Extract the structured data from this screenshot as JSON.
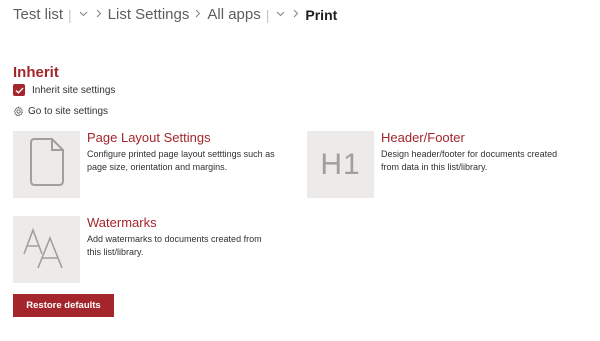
{
  "breadcrumb": {
    "items": [
      {
        "label": "Test list"
      },
      {
        "label": "List Settings"
      },
      {
        "label": "All apps"
      },
      {
        "label": "Print"
      }
    ]
  },
  "inherit": {
    "title": "Inherit",
    "checkbox_label": "Inherit site settings",
    "checked": true,
    "goto_label": "Go to site settings"
  },
  "tiles": [
    {
      "icon": "document-icon",
      "title": "Page Layout Settings",
      "desc_line1": "Configure printed page layout setttings such as",
      "desc_line2": "page size, orientation and margins."
    },
    {
      "icon": "h1-icon",
      "icon_text": "H1",
      "title": "Header/Footer",
      "desc_line1": "Design header/footer for documents created",
      "desc_line2": "from data in this list/library."
    },
    {
      "icon": "watermark-icon",
      "title": "Watermarks",
      "desc_line1": "Add watermarks to documents created from",
      "desc_line2": "this list/library."
    }
  ],
  "restore_label": "Restore defaults",
  "colors": {
    "accent": "#a4262c",
    "tile_bg": "#edebe9",
    "icon_gray": "#a19f9d"
  }
}
